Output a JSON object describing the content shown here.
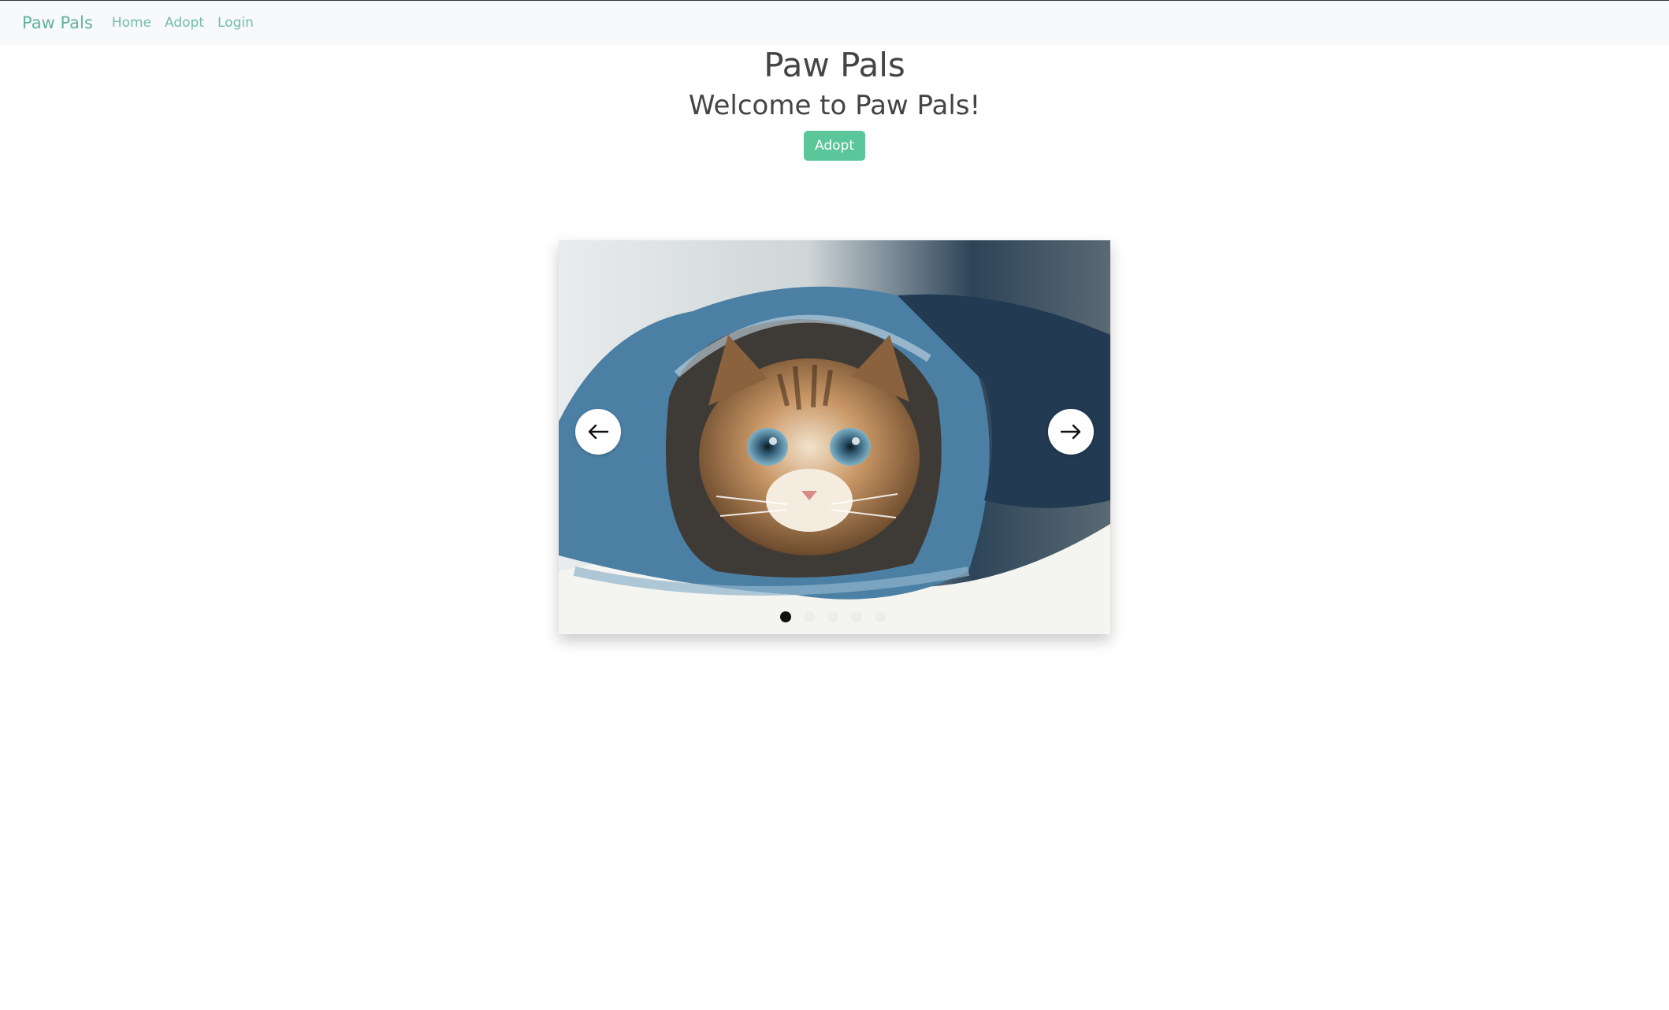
{
  "nav": {
    "brand": "Paw Pals",
    "links": [
      "Home",
      "Adopt",
      "Login"
    ]
  },
  "hero": {
    "title": "Paw Pals",
    "subtitle": "Welcome to Paw Pals!",
    "button_label": "Adopt"
  },
  "carousel": {
    "slide_count": 5,
    "active_index": 0,
    "image_subject": "kitten-in-jeans",
    "prev_icon": "arrow-left-icon",
    "next_icon": "arrow-right-icon"
  },
  "colors": {
    "brand": "#5fb49c",
    "accent_button": "#5ac69a",
    "navbar_bg": "#f8f9fa",
    "heading_text": "#444444"
  }
}
